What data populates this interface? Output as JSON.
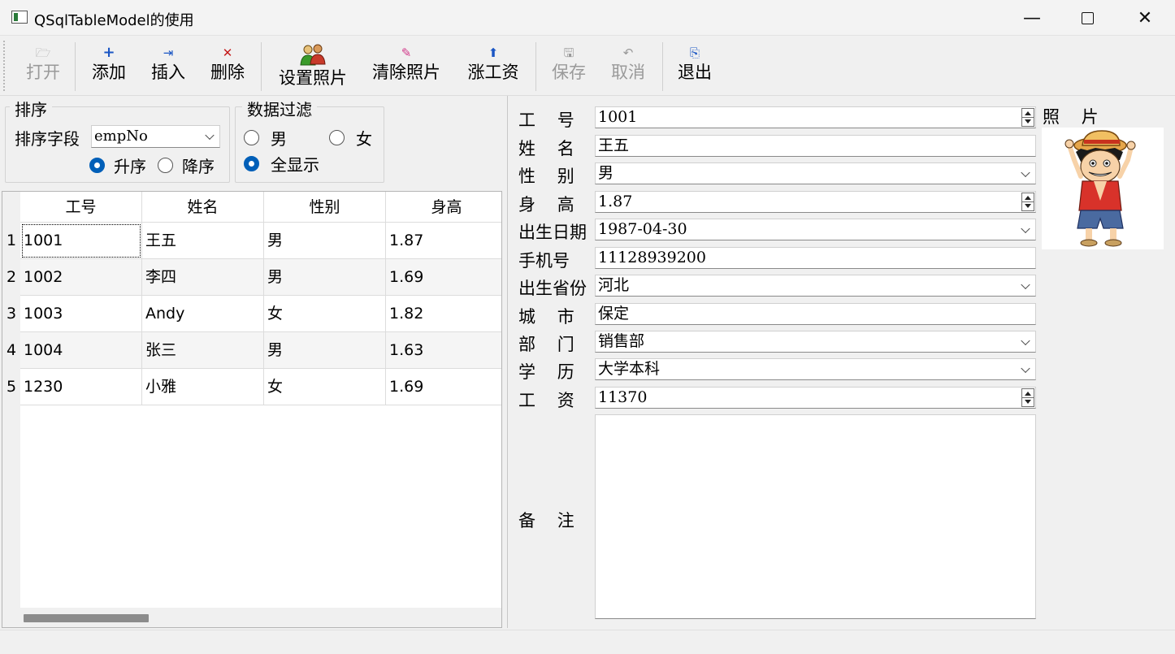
{
  "window": {
    "title": "QSqlTableModel的使用"
  },
  "toolbar": {
    "open": "打开",
    "add": "添加",
    "insert": "插入",
    "delete": "删除",
    "set_photo": "设置照片",
    "clear_photo": "清除照片",
    "raise_salary": "涨工资",
    "save": "保存",
    "cancel": "取消",
    "exit": "退出"
  },
  "sort": {
    "group_title": "排序",
    "field_label": "排序字段",
    "field_value": "empNo",
    "ascending": "升序",
    "descending": "降序",
    "selected": "ascending"
  },
  "filter": {
    "group_title": "数据过滤",
    "male": "男",
    "female": "女",
    "all": "全显示",
    "selected": "all"
  },
  "table": {
    "headers": [
      "工号",
      "姓名",
      "性别",
      "身高"
    ],
    "rows": [
      {
        "num": "1",
        "cells": [
          "1001",
          "王五",
          "男",
          "1.87"
        ]
      },
      {
        "num": "2",
        "cells": [
          "1002",
          "李四",
          "男",
          "1.69"
        ]
      },
      {
        "num": "3",
        "cells": [
          "1003",
          "Andy",
          "女",
          "1.82"
        ]
      },
      {
        "num": "4",
        "cells": [
          "1004",
          "张三",
          "男",
          "1.63"
        ]
      },
      {
        "num": "5",
        "cells": [
          "1230",
          "小雅",
          "女",
          "1.69"
        ]
      }
    ]
  },
  "form": {
    "emp_no_label": "工    号",
    "emp_no": "1001",
    "name_label": "姓    名",
    "name": "王五",
    "gender_label": "性    别",
    "gender": "男",
    "height_label": "身    高",
    "height": "1.87",
    "birthday_label": "出生日期",
    "birthday": "1987-04-30",
    "phone_label": "手机号",
    "phone": "11128939200",
    "province_label": "出生省份",
    "province": "河北",
    "city_label": "城    市",
    "city": "保定",
    "department_label": "部    门",
    "department": "销售部",
    "education_label": "学    历",
    "education": "大学本科",
    "salary_label": "工    资",
    "salary": "11370",
    "memo_label": "备    注",
    "memo": "",
    "photo_label": "照    片"
  },
  "colors": {
    "accent": "#005fb8",
    "focus": "#000000"
  }
}
